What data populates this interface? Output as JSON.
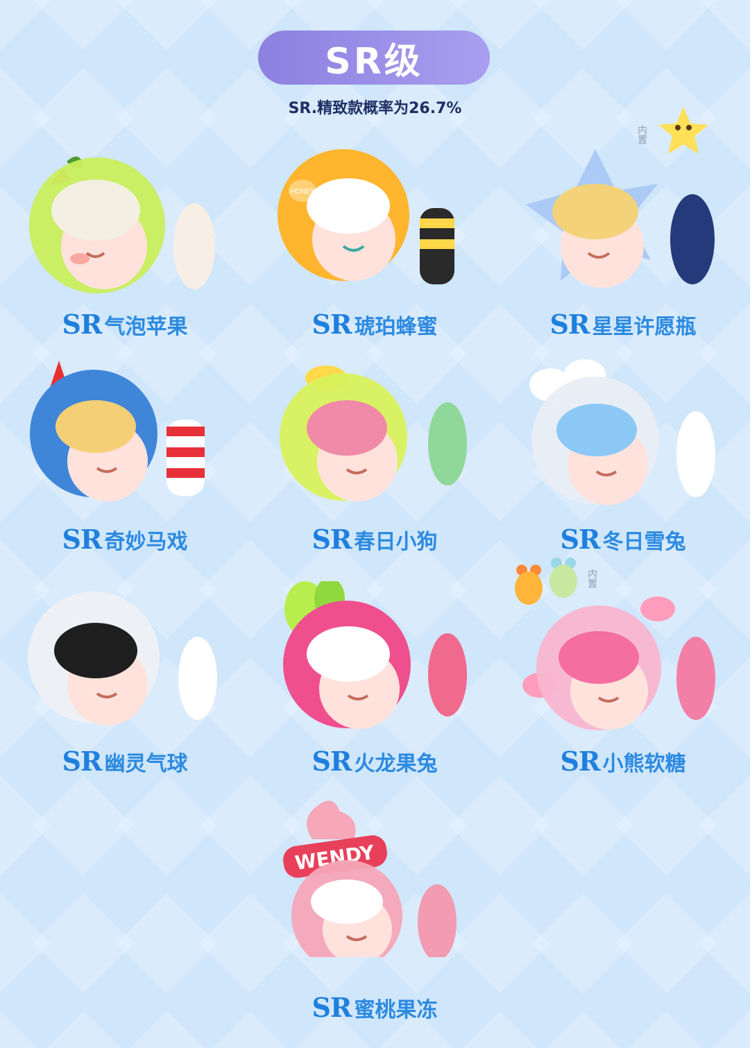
{
  "header": {
    "title": "SR级",
    "subtitle": "SR.精致款概率为26.7%"
  },
  "items": [
    {
      "prefix": "SR",
      "name": "气泡苹果",
      "helmet": "#c9ee5c",
      "hair": "#f4efe3",
      "suit": "#f7efe5",
      "accent": "#ff7a3c"
    },
    {
      "prefix": "SR",
      "name": "琥珀蜂蜜",
      "helmet": "#ffb52e",
      "hair": "#ffffff",
      "suit": "#2a2a2a",
      "accent": "#ffd84a"
    },
    {
      "prefix": "SR",
      "name": "星星许愿瓶",
      "helmet": "#a9c8f5",
      "hair": "#f3d27a",
      "suit": "#243a7a",
      "accent": "#ffe056"
    },
    {
      "prefix": "SR",
      "name": "奇妙马戏",
      "helmet": "#3f86d9",
      "hair": "#f4cf76",
      "suit": "#e8303a",
      "accent": "#ff3b3b"
    },
    {
      "prefix": "SR",
      "name": "春日小狗",
      "helmet": "#d9f25c",
      "hair": "#f08aa8",
      "suit": "#8fd89a",
      "accent": "#ffd94a"
    },
    {
      "prefix": "SR",
      "name": "冬日雪兔",
      "helmet": "#e9eef5",
      "hair": "#8cc8f5",
      "suit": "#ffffff",
      "accent": "#ffffff"
    },
    {
      "prefix": "SR",
      "name": "幽灵气球",
      "helmet": "#eef1f4",
      "hair": "#1e1e1e",
      "suit": "#ffffff",
      "accent": "#ffffff"
    },
    {
      "prefix": "SR",
      "name": "火龙果兔",
      "helmet": "#f04f8e",
      "hair": "#ffffff",
      "suit": "#f06a8e",
      "accent": "#b7ee4e"
    },
    {
      "prefix": "SR",
      "name": "小熊软糖",
      "helmet": "#f9b6cf",
      "hair": "#f46ea0",
      "suit": "#f47fa6",
      "accent": "#ff9ebc"
    },
    {
      "prefix": "SR",
      "name": "蜜桃果冻",
      "helmet": "#f6a7b8",
      "hair": "#ffffff",
      "suit": "#f39bb0",
      "accent": "#e8405a"
    }
  ],
  "notes": {
    "star_inside": "内置",
    "bear_inside": "内置",
    "hat_text": "WENDY",
    "honey_text": "HONEY"
  }
}
